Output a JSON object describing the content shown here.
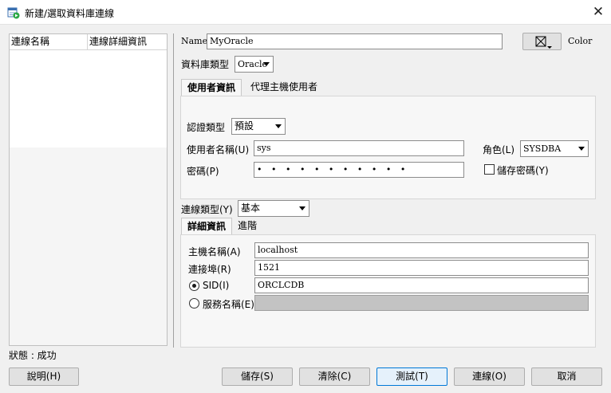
{
  "window": {
    "title": "新建/選取資料庫連線",
    "close_glyph": "✕"
  },
  "connections_table": {
    "columns": [
      "連線名稱",
      "連線詳細資訊"
    ]
  },
  "form": {
    "name_label": "Name",
    "name_value": "MyOracle",
    "color_label": "Color",
    "db_type_label": "資料庫類型",
    "db_type_value": "Oracle",
    "tabs": [
      "使用者資訊",
      "代理主機使用者"
    ],
    "auth_type_label": "認證類型",
    "auth_type_value": "預設",
    "username_label": "使用者名稱(U)",
    "username_value": "sys",
    "password_label": "密碼(P)",
    "password_value": "• • • • • • • • • • •",
    "role_label": "角色(L)",
    "role_value": "SYSDBA",
    "save_password_label": "儲存密碼(Y)",
    "conn_type_label": "連線類型(Y)",
    "conn_type_value": "基本",
    "detail_tabs": [
      "詳細資訊",
      "進階"
    ],
    "host_label": "主機名稱(A)",
    "host_value": "localhost",
    "port_label": "連接埠(R)",
    "port_value": "1521",
    "sid_label": "SID(I)",
    "sid_value": "ORCLCDB",
    "service_label": "服務名稱(E)",
    "service_value": ""
  },
  "status": {
    "text": "狀態 : 成功"
  },
  "buttons": {
    "help": "說明(H)",
    "save": "儲存(S)",
    "clear": "清除(C)",
    "test": "測試(T)",
    "connect": "連線(O)",
    "cancel": "取消"
  },
  "colors": {
    "accent": "#0078d7",
    "disabled_field": "#c3c3c3"
  }
}
